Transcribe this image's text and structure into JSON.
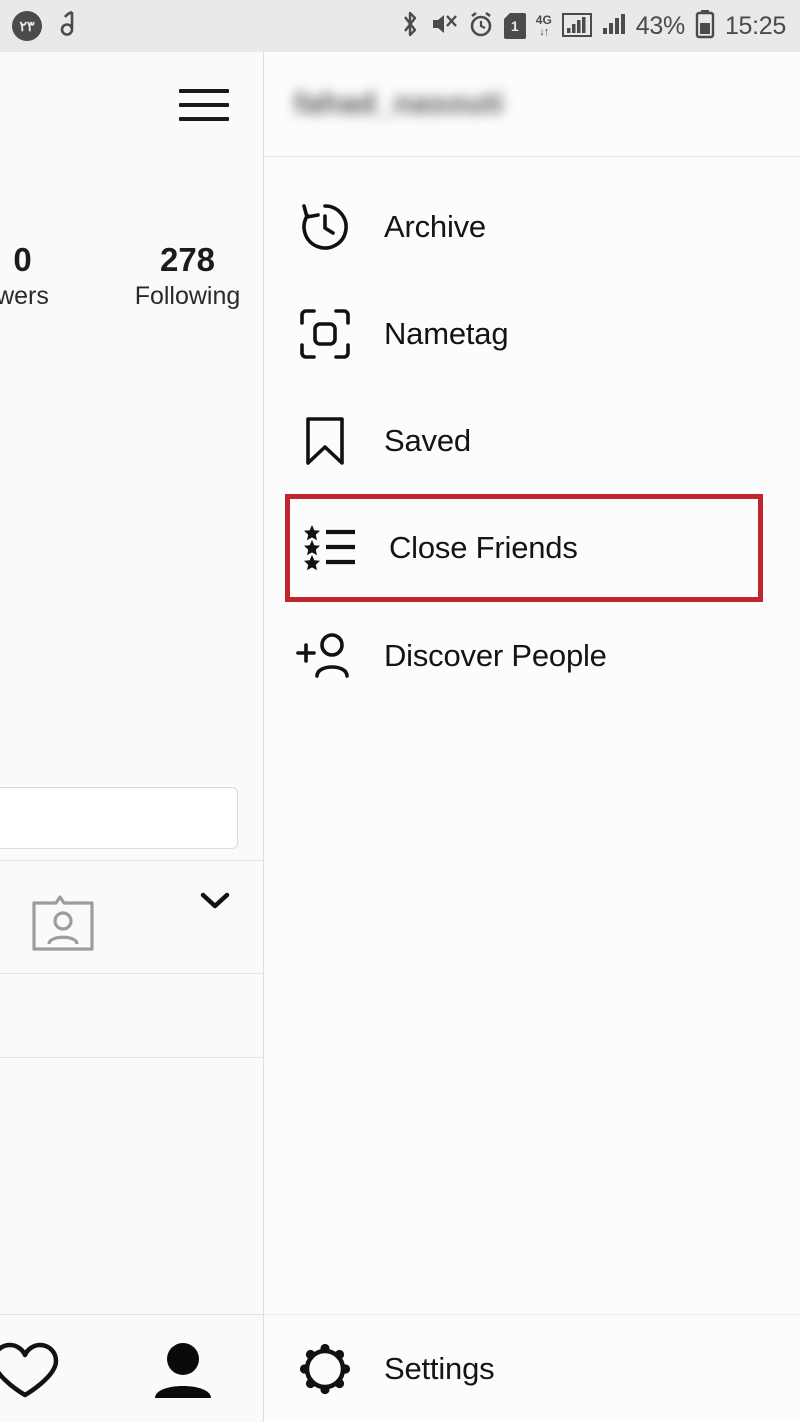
{
  "status_bar": {
    "left_badge_text": "۲۳",
    "left_icons": [
      "notification-badge",
      "music-note-icon"
    ],
    "right_icons": [
      "bluetooth-icon",
      "volume-mute-icon",
      "alarm-icon",
      "sim1-icon",
      "4g-data-icon",
      "signal-bars-1-icon",
      "signal-bars-2-icon",
      "battery-icon"
    ],
    "sim_label": "1",
    "network_label": "4G",
    "battery_percent": "43%",
    "clock": "15:25"
  },
  "profile_panel": {
    "menu_button": "hamburger-menu",
    "stats": [
      {
        "number": "0",
        "label": "wers"
      },
      {
        "number": "278",
        "label": "Following"
      }
    ],
    "edit_profile_button": "",
    "expand_chevron": "chevron-down-icon",
    "nametag_card": "nametag-card-icon",
    "bottom_nav": [
      {
        "name": "activity-heart",
        "active": false
      },
      {
        "name": "profile-person",
        "active": true
      }
    ]
  },
  "drawer": {
    "username": "fahad_nasouti",
    "items": [
      {
        "label": "Archive",
        "icon": "archive-clock-icon",
        "highlighted": false
      },
      {
        "label": "Nametag",
        "icon": "nametag-scan-icon",
        "highlighted": false
      },
      {
        "label": "Saved",
        "icon": "bookmark-icon",
        "highlighted": false
      },
      {
        "label": "Close Friends",
        "icon": "star-list-icon",
        "highlighted": true
      },
      {
        "label": "Discover People",
        "icon": "person-add-icon",
        "highlighted": false
      }
    ],
    "settings": {
      "label": "Settings",
      "icon": "gear-icon"
    }
  },
  "colors": {
    "highlight_red": "#c0272d",
    "status_bar_bg": "#e9e9e9",
    "drawer_bg": "#fcfcfc",
    "panel_bg": "#fafafa",
    "text": "#141414"
  }
}
